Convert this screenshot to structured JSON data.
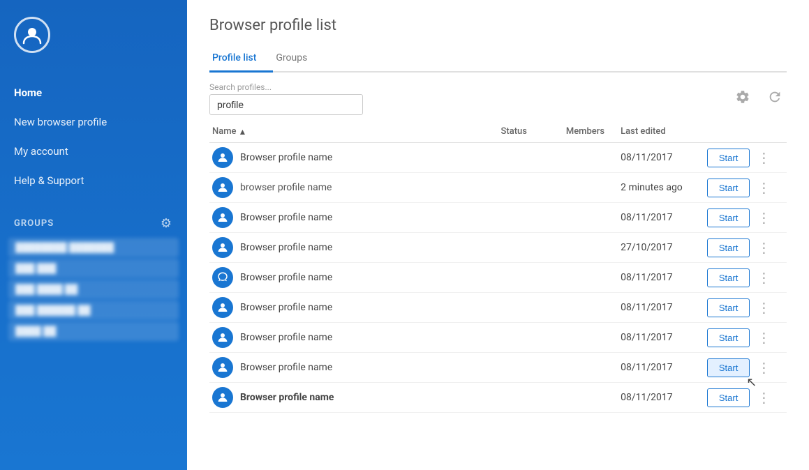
{
  "sidebar": {
    "logo_alt": "App logo",
    "nav": [
      {
        "label": "Home",
        "active": true
      },
      {
        "label": "New browser profile",
        "active": false
      },
      {
        "label": "My account",
        "active": false
      },
      {
        "label": "Help & Support",
        "active": false
      }
    ],
    "groups_label": "GROUPS",
    "groups_gear_title": "Groups settings",
    "group_items": [
      {
        "label": "████████ ███████"
      },
      {
        "label": "███ ███"
      },
      {
        "label": "███ ████ ██"
      },
      {
        "label": "███ ██████ ██"
      },
      {
        "label": "████ ██"
      }
    ]
  },
  "main": {
    "page_title": "Browser profile list",
    "tabs": [
      {
        "label": "Profile list",
        "active": true
      },
      {
        "label": "Groups",
        "active": false
      }
    ],
    "search": {
      "label": "Search profiles...",
      "value": "profile",
      "placeholder": "Search profiles..."
    },
    "toolbar_settings_title": "Settings",
    "toolbar_refresh_title": "Refresh",
    "table": {
      "columns": [
        {
          "key": "name",
          "label": "Name",
          "sortable": true
        },
        {
          "key": "status",
          "label": "Status"
        },
        {
          "key": "members",
          "label": "Members"
        },
        {
          "key": "last_edited",
          "label": "Last edited"
        },
        {
          "key": "actions",
          "label": ""
        }
      ],
      "rows": [
        {
          "name": "Browser profile name",
          "last_edited": "08/11/2017",
          "bold": false,
          "light": false,
          "partial": true,
          "fox": false
        },
        {
          "name": "browser profile name",
          "last_edited": "2 minutes ago",
          "bold": false,
          "light": true,
          "partial": false,
          "fox": false
        },
        {
          "name": "Browser profile name",
          "last_edited": "08/11/2017",
          "bold": false,
          "light": false,
          "partial": false,
          "fox": false
        },
        {
          "name": "Browser profile name",
          "last_edited": "27/10/2017",
          "bold": false,
          "light": false,
          "partial": false,
          "fox": false
        },
        {
          "name": "Browser profile name",
          "last_edited": "08/11/2017",
          "bold": false,
          "light": false,
          "partial": false,
          "fox": true
        },
        {
          "name": "Browser profile name",
          "last_edited": "08/11/2017",
          "bold": false,
          "light": false,
          "partial": false,
          "fox": false
        },
        {
          "name": "Browser profile name",
          "last_edited": "08/11/2017",
          "bold": false,
          "light": false,
          "partial": false,
          "fox": false
        },
        {
          "name": "Browser profile name",
          "last_edited": "08/11/2017",
          "bold": false,
          "light": false,
          "partial": false,
          "fox": false,
          "cursor": true
        },
        {
          "name": "Browser profile name",
          "last_edited": "08/11/2017",
          "bold": true,
          "light": false,
          "partial": false,
          "fox": false
        }
      ],
      "start_label": "Start"
    }
  }
}
